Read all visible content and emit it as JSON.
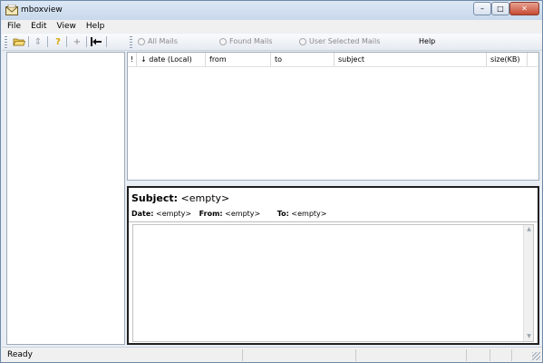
{
  "window": {
    "title": "mboxview"
  },
  "titlebar": {
    "minimize": "–",
    "maximize": "□",
    "close": "✕"
  },
  "menu": {
    "items": [
      "File",
      "Edit",
      "View",
      "Help"
    ]
  },
  "toolbar": {
    "radio_all": "All Mails",
    "radio_found": "Found Mails",
    "radio_selected": "User Selected Mails",
    "help": "Help"
  },
  "list": {
    "columns": {
      "flag": "!",
      "date": "↓ date (Local)",
      "from": "from",
      "to": "to",
      "subject": "subject",
      "size": "size(KB)"
    }
  },
  "preview": {
    "subject_label": "Subject:",
    "subject_value": "<empty>",
    "date_label": "Date:",
    "date_value": "<empty>",
    "from_label": "From:",
    "from_value": "<empty>",
    "to_label": "To:",
    "to_value": "<empty>"
  },
  "statusbar": {
    "text": "Ready"
  },
  "colors": {
    "accent": "#6f8aa8",
    "window_bg": "#e9eef5",
    "close": "#c74a33"
  }
}
